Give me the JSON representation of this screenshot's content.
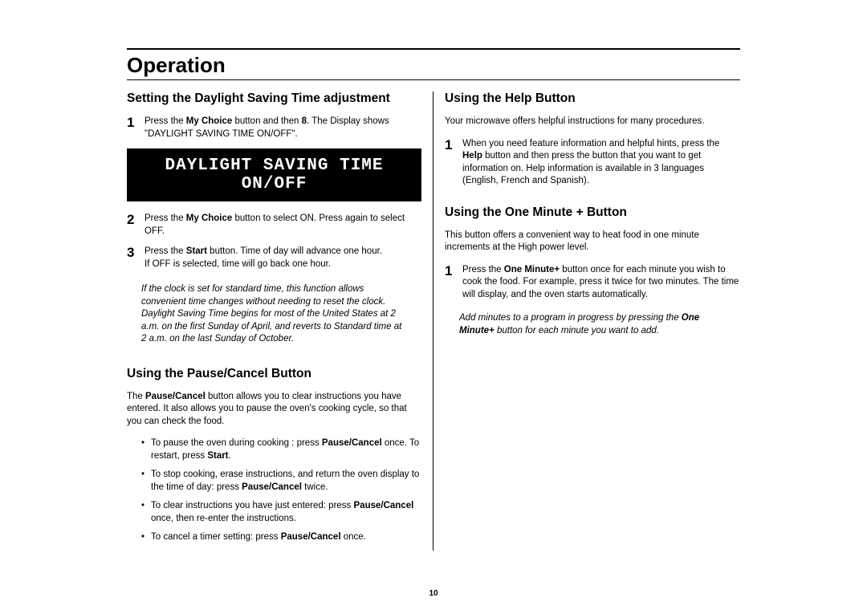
{
  "page_title": "Operation",
  "page_number": "10",
  "left": {
    "dst": {
      "heading": "Setting the Daylight Saving Time adjustment",
      "step1_num": "1",
      "step1_a": "Press the ",
      "step1_b_bold": "My Choice",
      "step1_c": " button and then ",
      "step1_d_bold": "8",
      "step1_e": ". The Display shows \"DAYLIGHT SAVING TIME ON/OFF\".",
      "lcd": "DAYLIGHT SAVING TIME ON/OFF",
      "step2_num": "2",
      "step2_a": "Press the ",
      "step2_b_bold": "My Choice",
      "step2_c": " button to select ON. Press again to select OFF.",
      "step3_num": "3",
      "step3_a": "Press the ",
      "step3_b_bold": "Start",
      "step3_c": " button. Time of day will advance one hour.",
      "step3_d": "If OFF is selected, time will go back one hour.",
      "note": "If the clock is set for standard time, this function allows convenient time changes without needing to reset the clock. Daylight Saving Time begins for most of the United States at 2 a.m. on the first Sunday of April, and reverts to Standard time at 2 a.m. on the last Sunday of October."
    },
    "pause": {
      "heading": "Using the Pause/Cancel Button",
      "intro_a": "The ",
      "intro_b_bold": "Pause/Cancel",
      "intro_c": " button allows you to clear instructions you have entered. It also allows you to pause the oven's cooking cycle, so that you can check the food.",
      "b1_a": "To pause the oven during cooking : press ",
      "b1_b_bold": "Pause/Cancel",
      "b1_c": " once. To restart, press ",
      "b1_d_bold": "Start",
      "b1_e": ".",
      "b2_a": "To stop cooking, erase instructions, and return the oven display to the time of day: press ",
      "b2_b_bold": "Pause/Cancel",
      "b2_c": " twice.",
      "b3_a": "To clear instructions you have just entered: press ",
      "b3_b_bold": "Pause/Cancel",
      "b3_c": " once, then re-enter the instructions.",
      "b4_a": "To cancel a timer setting: press ",
      "b4_b_bold": "Pause/Cancel",
      "b4_c": " once."
    }
  },
  "right": {
    "help": {
      "heading": "Using the Help Button",
      "intro": "Your microwave offers helpful instructions for many procedures.",
      "step1_num": "1",
      "step1_a": "When you need feature information and helpful hints, press the ",
      "step1_b_bold": "Help",
      "step1_c": " button and then press the button that you want to get information on. Help information is available in 3 languages (English, French and Spanish)."
    },
    "oneminute": {
      "heading": "Using the One Minute + Button",
      "intro": "This button offers a convenient way to heat food in one minute increments at the High power level.",
      "step1_num": "1",
      "step1_a": "Press the ",
      "step1_b_bold": "One Minute+",
      "step1_c": " button once for each minute you wish to cook the food. For example, press it twice for two minutes. The time will display, and the oven starts automatically.",
      "note_a": "Add minutes to a program in progress by pressing the ",
      "note_b_bolditalic": "One Minute+",
      "note_c": " button for each minute you want to add."
    }
  }
}
